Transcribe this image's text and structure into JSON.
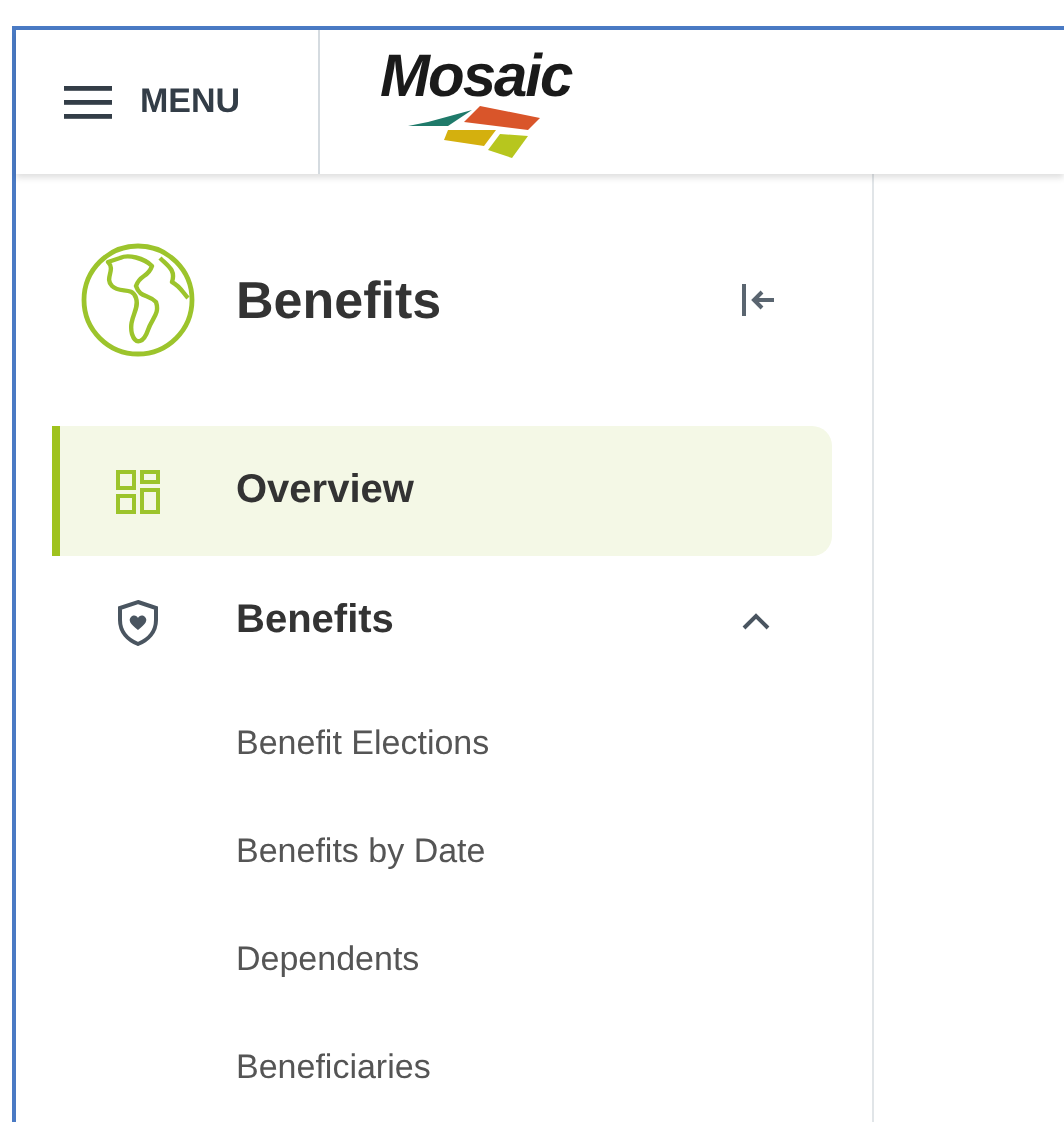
{
  "header": {
    "menu_label": "MENU",
    "logo_text": "Mosaic"
  },
  "sidebar": {
    "title": "Benefits",
    "items": [
      {
        "kind": "link",
        "label": "Overview",
        "selected": true
      },
      {
        "kind": "group",
        "label": "Benefits",
        "selected": false,
        "expanded": true,
        "children": [
          {
            "label": "Benefit Elections",
            "selected": false
          },
          {
            "label": "Benefits by Date",
            "selected": false
          },
          {
            "label": "Dependents",
            "selected": false
          },
          {
            "label": "Beneficiaries",
            "selected": false
          }
        ]
      }
    ]
  }
}
